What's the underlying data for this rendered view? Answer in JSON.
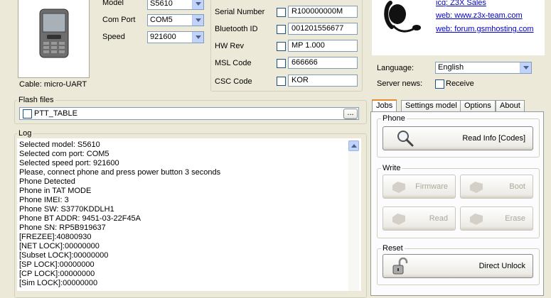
{
  "device": {
    "cable_label": "Cable: micro-UART",
    "model_label": "Model",
    "model_value": "S5610",
    "comport_label": "Com Port",
    "comport_value": "COM5",
    "speed_label": "Speed",
    "speed_value": "921600"
  },
  "info": {
    "serial_label": "Serial Number",
    "serial_value": "R100000000M",
    "bt_label": "Bluetooth ID",
    "bt_value": "001201556677",
    "hwrev_label": "HW Rev",
    "hwrev_value": "MP 1.000",
    "msl_label": "MSL Code",
    "msl_value": "666666",
    "csc_label": "CSC Code",
    "csc_value": "KOR"
  },
  "contact": {
    "icq": "icq: Z3X Sales",
    "web": "web: www.z3x-team.com",
    "forum": "web: forum.gsmhosting.com"
  },
  "settings": {
    "language_label": "Language:",
    "language_value": "English",
    "server_news_label": "Server news:",
    "receive_label": "Receive"
  },
  "flash": {
    "title": "Flash files",
    "file": "PTT_TABLE",
    "browse_label": "..."
  },
  "log": {
    "title": "Log",
    "lines": [
      "Selected model: S5610",
      "Selected com port: COM5",
      "Selected speed port: 921600",
      "Please, connect phone and press power button 3 seconds",
      "Phone Detected",
      "Phone in TAT MODE",
      "Phone IMEI: 3",
      "Phone SW: S3770KDDLH1",
      "Phone BT ADDR: 9451-03-22F45A",
      "Phone SN: RP5B919637",
      "[FREZEE]:40800930",
      "[NET LOCK]:00000000",
      "[Subset LOCK]:00000000",
      "[SP LOCK]:00000000",
      "[CP LOCK]:00000000",
      "[Sim LOCK]:00000000"
    ]
  },
  "tabs": [
    "Jobs",
    "Settings model",
    "Options",
    "About"
  ],
  "jobs": {
    "phone_title": "Phone",
    "read_info_label": "Read Info [Codes]",
    "write_title": "Write",
    "firmware_label": "Firmware",
    "boot_label": "Boot",
    "read_label": "Read",
    "erase_label": "Erase",
    "reset_title": "Reset",
    "direct_unlock_label": "Direct Unlock"
  }
}
